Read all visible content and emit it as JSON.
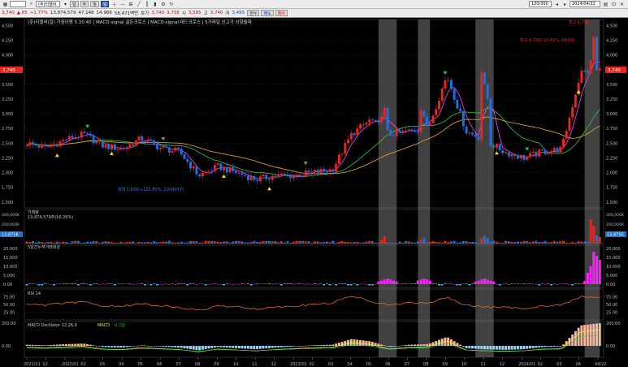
{
  "toolbar": {
    "code": "",
    "name": "(주)티엘비",
    "mode": "일",
    "date_label": "2024/04/22",
    "count_label": "130/300",
    "tab1_label": "일",
    "tab2_label": "주",
    "tab3_label": "월"
  },
  "quote": {
    "price": "3,740",
    "change": "65",
    "change_pct": "+1.77%",
    "volume": "13,874,579",
    "vol_ratio": "47,148",
    "ratio2": "14.966",
    "amount": "58,471백만",
    "hoga_label": "호가",
    "hoga_val": "3,740",
    "high": "3,735",
    "low_label": "시",
    "low_val": "3,595",
    "open_label": "고",
    "open_val": "3,740",
    "close_label": "저",
    "close_val": "3,455",
    "btn_a": "현수",
    "btn_b": "매도",
    "btn_c": "매수"
  },
  "legend": {
    "main": "(주)티엘비(일) 가중이평 5 20 40 | MACD-signal 골든크로스 | MACD-signal 데드크로스 | 5거래일 신고가 상향돌파",
    "volume": "거래량",
    "volume_val": "13,874,579주(16.26%)",
    "trade": "5일간누적거래대금",
    "rsi": "RSI 14",
    "macd": "MACD Oscillator 12,26,9",
    "macd_line": "MACD",
    "signal_line": "시그널",
    "top_right_max": "최고 4,730",
    "hi_note": "최고 4,730(-13.41%, 04/16)",
    "lo_note": "최저 1,656(+125.85%, 22/08/17)"
  },
  "price_axis": [
    "4,500",
    "4,250",
    "4,000",
    "3,750",
    "3,500",
    "3,250",
    "3,000",
    "2,750",
    "2,500",
    "2,250",
    "2,000",
    "1,750",
    "1,500"
  ],
  "current_price_tag": "3,740",
  "vol_axis": [
    "300,000K",
    "200,000K",
    "100,000K"
  ],
  "vol_tag": "13,875K",
  "trade_axis": [
    "20,000",
    "15,000",
    "10,000",
    "5,000",
    "0.00"
  ],
  "rsi_axis": [
    "75.00",
    "50.00",
    "25.00"
  ],
  "macd_axis": [
    "200.00",
    "0.00"
  ],
  "date_axis": [
    "2021/11",
    "12",
    "2022/01",
    "02",
    "03",
    "04",
    "05",
    "06",
    "07",
    "08",
    "09",
    "10",
    "11",
    "12",
    "2023/01",
    "02",
    "03",
    "04",
    "05",
    "06",
    "07",
    "08",
    "09",
    "10",
    "11",
    "12",
    "2024/01",
    "02",
    "03",
    "04",
    "04/22"
  ],
  "colors": {
    "up": "#e8261e",
    "down": "#1e6fe0",
    "ma5": "#ff40ff",
    "ma20": "#2ecc40",
    "ma40": "#f0b020",
    "trade": "#ff20ff",
    "rsi": "#e06a1a",
    "macd": "#ffeb3b",
    "signal": "#2ecc40",
    "hl": "#777777"
  },
  "chart_data": [
    {
      "type": "line",
      "title": "(주)티엘비(일)",
      "ylim": [
        1400,
        4600
      ],
      "x": [
        "2021/11",
        "12",
        "2022/01",
        "02",
        "03",
        "04",
        "05",
        "06",
        "07",
        "08",
        "09",
        "10",
        "11",
        "12",
        "2023/01",
        "02",
        "03",
        "04",
        "05",
        "06",
        "07",
        "08",
        "09",
        "10",
        "11",
        "12",
        "2024/01",
        "02",
        "03",
        "04",
        "04/22"
      ],
      "series": [
        {
          "name": "종가",
          "values": [
            2500,
            2420,
            2560,
            2650,
            2450,
            2400,
            2580,
            2420,
            2350,
            1950,
            2100,
            2000,
            1880,
            1950,
            1950,
            2000,
            2050,
            2650,
            2900,
            2650,
            2700,
            2750,
            3650,
            2700,
            2550,
            2350,
            2250,
            2350,
            2400,
            3700,
            3740
          ]
        }
      ],
      "annotations": [
        "최고 4,730(-13.41%, 04/16)",
        "최저 1,656(+125.85%, 22/08/17)"
      ]
    },
    {
      "type": "line",
      "title": "RSI 14",
      "ylim": [
        0,
        100
      ],
      "series": [
        {
          "name": "RSI 14",
          "values": [
            50,
            48,
            55,
            58,
            45,
            44,
            52,
            46,
            40,
            30,
            45,
            42,
            36,
            42,
            45,
            50,
            55,
            78,
            60,
            48,
            55,
            55,
            72,
            48,
            42,
            40,
            38,
            45,
            48,
            75,
            72
          ]
        }
      ]
    },
    {
      "type": "bar",
      "title": "MACD Oscillator 12,26,9",
      "series": [
        {
          "name": "MACD Oscillator",
          "values": [
            10,
            5,
            15,
            20,
            -10,
            -15,
            5,
            -5,
            -15,
            -40,
            -10,
            -20,
            -30,
            -15,
            -5,
            5,
            10,
            60,
            40,
            -10,
            10,
            15,
            80,
            -20,
            -30,
            -35,
            -30,
            -10,
            -5,
            180,
            200
          ]
        }
      ]
    }
  ]
}
